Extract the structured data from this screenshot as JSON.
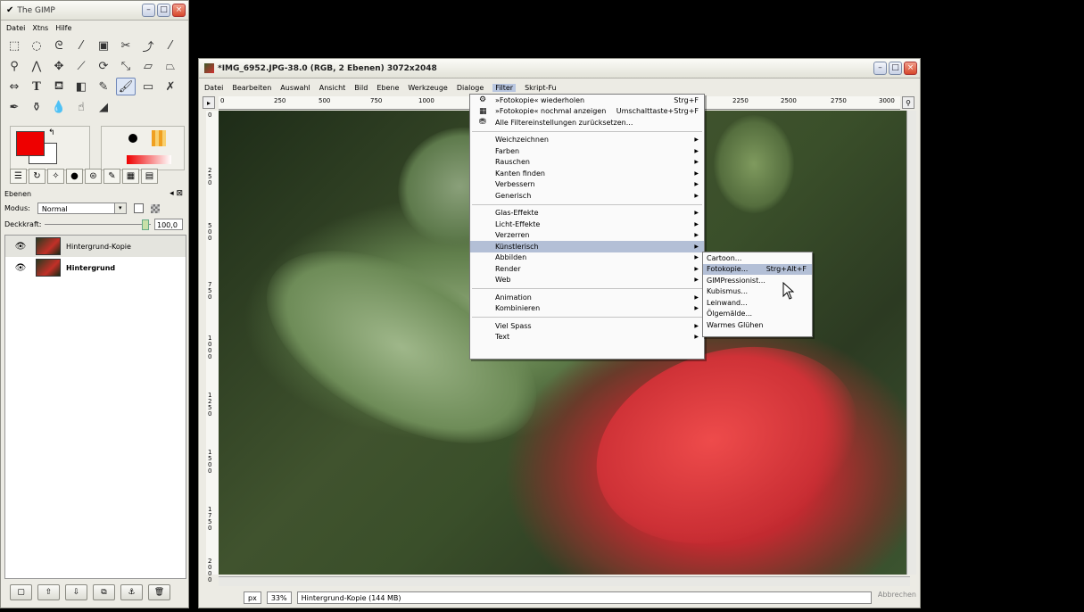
{
  "toolbox": {
    "title": "The GIMP",
    "menus": [
      "Datei",
      "Xtns",
      "Hilfe"
    ],
    "layers_panel": {
      "title": "Ebenen",
      "modus_label": "Modus:",
      "modus_value": "Normal",
      "opacity_label": "Deckkraft:",
      "opacity_value": "100,0",
      "layers": [
        "Hintergrund-Kopie",
        "Hintergrund"
      ]
    }
  },
  "image_window": {
    "title": "*IMG_6952.JPG-38.0 (RGB, 2 Ebenen) 3072x2048",
    "menus": [
      "Datei",
      "Bearbeiten",
      "Auswahl",
      "Ansicht",
      "Bild",
      "Ebene",
      "Werkzeuge",
      "Dialoge",
      "Filter",
      "Skript-Fu"
    ],
    "hruler_labels": [
      "0",
      "250",
      "500",
      "750",
      "1000",
      "2250",
      "2500",
      "2750",
      "3000"
    ],
    "vruler_labels": [
      "0",
      "250",
      "500",
      "750",
      "1000",
      "1250",
      "1500",
      "1750",
      "2000"
    ],
    "status": {
      "unit": "px",
      "zoom": "33%",
      "info": "Hintergrund-Kopie (144 MB)",
      "cancel": "Abbrechen"
    }
  },
  "filter_menu": {
    "repeat": {
      "label": "»Fotokopie« wiederholen",
      "shortcut": "Strg+F"
    },
    "reshow": {
      "label": "»Fotokopie« nochmal anzeigen",
      "shortcut": "Umschalttaste+Strg+F"
    },
    "reset": {
      "label": "Alle Filtereinstellungen zurücksetzen..."
    },
    "group1": [
      "Weichzeichnen",
      "Farben",
      "Rauschen",
      "Kanten finden",
      "Verbessern",
      "Generisch"
    ],
    "group2": [
      "Glas-Effekte",
      "Licht-Effekte",
      "Verzerren",
      "Künstlerisch",
      "Abbilden",
      "Render",
      "Web"
    ],
    "group3": [
      "Animation",
      "Kombinieren"
    ],
    "group4": [
      "Viel Spass",
      "Text"
    ]
  },
  "artistic_menu": {
    "items": [
      {
        "label": "Cartoon...",
        "shortcut": ""
      },
      {
        "label": "Fotokopie...",
        "shortcut": "Strg+Alt+F"
      },
      {
        "label": "GIMPressionist...",
        "shortcut": ""
      },
      {
        "label": "Kubismus...",
        "shortcut": ""
      },
      {
        "label": "Leinwand...",
        "shortcut": ""
      },
      {
        "label": "Ölgemälde...",
        "shortcut": ""
      },
      {
        "label": "Warmes Glühen",
        "shortcut": ""
      }
    ]
  },
  "colors": {
    "foreground": "#ee0000",
    "background": "#ffffff",
    "menu_highlight": "#b3bfd6"
  }
}
